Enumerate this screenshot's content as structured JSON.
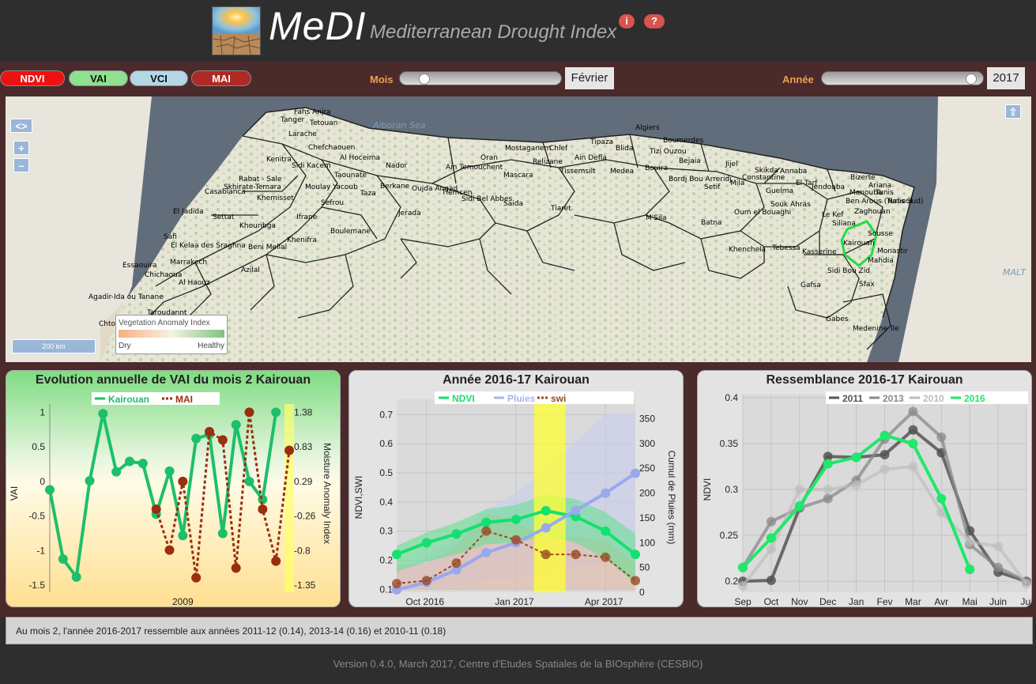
{
  "header": {
    "title": "MeDI",
    "subtitle": "Mediterranean Drought Index",
    "info_label": "i",
    "help_label": "?"
  },
  "indices": [
    {
      "label": "NDVI",
      "bg": "#ee1111",
      "fg": "#ffffff"
    },
    {
      "label": "VAI",
      "bg": "#8fe08f",
      "fg": "#111111"
    },
    {
      "label": "VCI",
      "bg": "#b4d7e6",
      "fg": "#111111"
    },
    {
      "label": "MAI",
      "bg": "#b02a25",
      "fg": "#ffffff"
    }
  ],
  "month_control": {
    "label": "Mois",
    "value": "Février",
    "fraction": 0.11
  },
  "year_control": {
    "label": "Année",
    "value": "2017",
    "fraction": 0.97
  },
  "map": {
    "legend_title": "Vegetation Anomaly Index",
    "legend_dry": "Dry",
    "legend_healthy": "Healthy",
    "scale_label": "200 km",
    "toggle_label": "<>",
    "zoom_in": "+",
    "zoom_out": "–",
    "share_label": "⇧",
    "seas": [
      "Alboran Sea",
      "MALT"
    ],
    "cities": [
      "Fahs Anjra",
      "Tanger",
      "Tetouan",
      "Larache",
      "Chefchaouen",
      "Al Hoceima",
      "Nador",
      "Kenitra",
      "Sidi Kacem",
      "Taounate",
      "Rabat - Sale",
      "Skhirate-Temara",
      "Moulay Yacoub",
      "Casablanca",
      "Khemisset",
      "Sefrou",
      "Taza",
      "Berkane",
      "Oujda Angad",
      "El Jadida",
      "Settat",
      "Ifrane",
      "Khouribga",
      "Boulemane",
      "Jerada",
      "Safi",
      "El Kelaa des Sraghna",
      "Beni Mellal",
      "Khenifra",
      "Essaouira",
      "Marrakech",
      "Chichaoua",
      "Azilal",
      "Al Haouz",
      "Agadir-Ida ou Tanane",
      "Taroudannt",
      "Chtouka",
      "Oran",
      "Mostaganem",
      "Chlef",
      "Tipaza",
      "Algiers",
      "Boumerdes",
      "Tizi Ouzou",
      "Bejaia",
      "Jijel",
      "Skikda",
      "Annaba",
      "El Tarf",
      "Ain Temouchent",
      "Ain Defla",
      "Blida",
      "Relizane",
      "Mascara",
      "Tissemsilt",
      "Medea",
      "Bouira",
      "Bordj Bou Arreridj",
      "Setif",
      "Mila",
      "Constantine",
      "Guelma",
      "Souk Ahras",
      "Tlemcen",
      "Sidi Bel Abbes",
      "Saida",
      "Tiaret",
      "M'Sila",
      "Batna",
      "Oum el Bouaghi",
      "Khenchela",
      "Tebessa",
      "Jendouba",
      "Bizerte",
      "Ariana",
      "Manouba",
      "Tunis",
      "Ben Arous (Tunis Sud)",
      "Nabeul",
      "Zaghouan",
      "Le Kef",
      "Siliana",
      "Kairouan",
      "Sousse",
      "Monastir",
      "Mahdia",
      "Kasserine",
      "Sidi Bou Zid",
      "Gafsa",
      "Sfax",
      "Gabes",
      "Medenine",
      "Ile"
    ]
  },
  "panel_vai": {
    "title": "Evolution annuelle de VAI du mois 2 Kairouan",
    "legend": [
      {
        "name": "Kairouan",
        "color": "#1dbf6a"
      },
      {
        "name": "MAI",
        "color": "#9a2e10"
      }
    ],
    "ylabel_left": "VAI",
    "ylabel_right": "Moisture Anomaly Index",
    "yticks_left": [
      "1",
      "0.5",
      "0",
      "-0.5",
      "-1",
      "-1.5"
    ],
    "yticks_right": [
      "1.38",
      "0.83",
      "0.29",
      "-0.26",
      "-0.8",
      "-1.35"
    ],
    "xtick": "2009"
  },
  "panel_year": {
    "title": "Année 2016-17 Kairouan",
    "legend": [
      {
        "name": "NDVI",
        "color": "#14e070"
      },
      {
        "name": "Pluies",
        "color": "#a8b4ef"
      },
      {
        "name": "swi",
        "color": "#9a4a20"
      }
    ],
    "ylabel_left": "NDVI,SWI",
    "ylabel_right": "Cumul de Pluies (mm)",
    "yticks_left": [
      "0.7",
      "0.6",
      "0.5",
      "0.4",
      "0.3",
      "0.2",
      "0.1"
    ],
    "yticks_right": [
      "350",
      "300",
      "250",
      "200",
      "150",
      "100",
      "50",
      "0"
    ],
    "xticks": [
      "Oct 2016",
      "Jan 2017",
      "Apr 2017"
    ]
  },
  "panel_similarity": {
    "title": "Ressemblance 2016-17 Kairouan",
    "legend": [
      {
        "name": "2011",
        "color": "#555555"
      },
      {
        "name": "2013",
        "color": "#8a8a8a"
      },
      {
        "name": "2010",
        "color": "#bdbdbd"
      },
      {
        "name": "2016",
        "color": "#1fe86a"
      }
    ],
    "ylabel": "NDVI",
    "yticks": [
      "0.4",
      "0.35",
      "0.3",
      "0.25",
      "0.2"
    ],
    "xticks": [
      "Sep",
      "Oct",
      "Nov",
      "Dec",
      "Jan",
      "Fev",
      "Mar",
      "Avr",
      "Mai",
      "Juin",
      "Jul"
    ]
  },
  "chart_data": [
    {
      "type": "line",
      "title": "Evolution annuelle de VAI du mois 2 Kairouan",
      "xlabel": "",
      "ylabel": "VAI",
      "y2label": "Moisture Anomaly Index",
      "ylim": [
        -1.6,
        1.05
      ],
      "series": [
        {
          "name": "Kairouan",
          "values": [
            -0.12,
            -1.12,
            -1.38,
            0.01,
            0.98,
            0.14,
            0.29,
            0.26,
            -0.47,
            0.15,
            -0.78,
            0.62,
            0.68,
            -0.75,
            0.82,
            0.0,
            -0.26,
            1.0
          ]
        },
        {
          "name": "MAI",
          "values": [
            null,
            null,
            null,
            null,
            null,
            null,
            null,
            null,
            -0.4,
            -0.99,
            0.0,
            -1.39,
            0.72,
            0.6,
            -1.25,
            1.0,
            -0.4,
            -1.15,
            0.45
          ]
        }
      ],
      "x": [
        1999,
        2000,
        2001,
        2002,
        2003,
        2004,
        2005,
        2006,
        2007,
        2008,
        2009,
        2010,
        2011,
        2012,
        2013,
        2014,
        2015,
        2016,
        2017
      ]
    },
    {
      "type": "line",
      "title": "Année 2016-17 Kairouan",
      "xlabel": "",
      "ylabel": "NDVI,SWI",
      "y2label": "Cumul de Pluies (mm)",
      "ylim": [
        0.1,
        0.7
      ],
      "y2lim": [
        0,
        350
      ],
      "x": [
        "2016-09-15",
        "2016-10-15",
        "2016-11-15",
        "2016-12-15",
        "2017-01-15",
        "2017-02-15",
        "2017-03-15",
        "2017-04-15",
        "2017-05-15"
      ],
      "series": [
        {
          "name": "NDVI",
          "values": [
            0.22,
            0.26,
            0.29,
            0.33,
            0.34,
            0.37,
            0.35,
            0.3,
            0.22
          ]
        },
        {
          "name": "Pluies",
          "axis": "right",
          "values": [
            5,
            20,
            45,
            80,
            100,
            130,
            165,
            200,
            240
          ]
        },
        {
          "name": "swi",
          "values": [
            0.12,
            0.13,
            0.19,
            0.3,
            0.27,
            0.22,
            0.22,
            0.21,
            0.13
          ]
        }
      ]
    },
    {
      "type": "line",
      "title": "Ressemblance 2016-17 Kairouan",
      "ylabel": "NDVI",
      "ylim": [
        0.19,
        0.4
      ],
      "categories": [
        "Sep",
        "Oct",
        "Nov",
        "Dec",
        "Jan",
        "Fev",
        "Mar",
        "Avr",
        "Mai",
        "Juin",
        "Jul"
      ],
      "series": [
        {
          "name": "2011",
          "values": [
            0.2,
            0.201,
            0.28,
            0.336,
            0.335,
            0.338,
            0.365,
            0.34,
            0.255,
            0.21,
            0.2
          ]
        },
        {
          "name": "2013",
          "values": [
            0.215,
            0.265,
            0.28,
            0.29,
            0.31,
            0.355,
            0.385,
            0.357,
            0.24,
            0.215,
            0.2
          ]
        },
        {
          "name": "2010",
          "values": [
            0.195,
            0.235,
            0.3,
            0.3,
            0.305,
            0.322,
            0.325,
            0.275,
            0.243,
            0.238,
            0.197
          ]
        },
        {
          "name": "2016",
          "values": [
            0.215,
            0.247,
            0.282,
            0.328,
            0.335,
            0.359,
            0.35,
            0.29,
            0.213,
            null,
            null
          ]
        }
      ]
    }
  ],
  "info_text": "Au mois 2, l'année 2016-2017 ressemble aux années 2011-12 (0.14), 2013-14 (0.16) et 2010-11 (0.18)",
  "footer_text": "Version 0.4.0, March 2017, Centre d'Etudes Spatiales de la BIOsphère (CESBIO)"
}
